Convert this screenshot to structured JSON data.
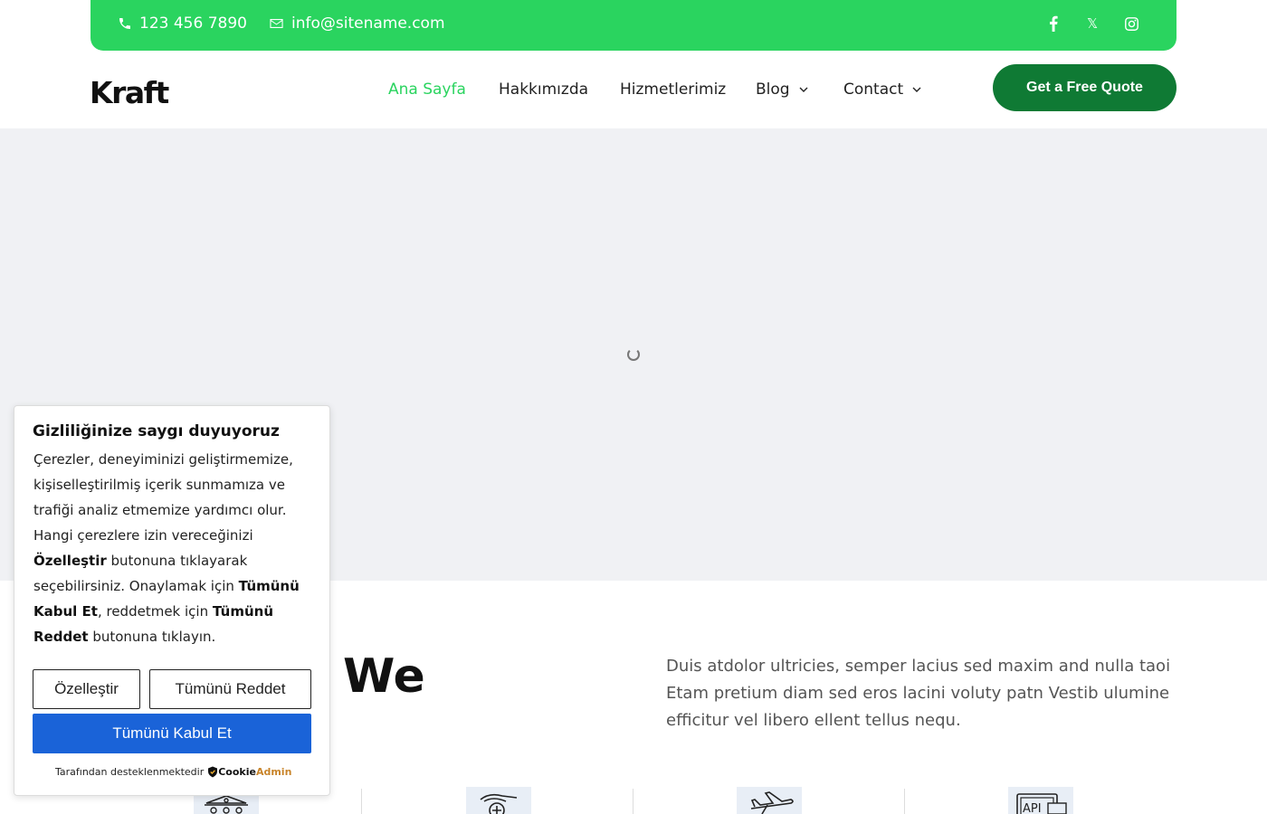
{
  "topbar": {
    "phone": "123 456 7890",
    "email": "info@sitename.com",
    "social": [
      "facebook-icon",
      "x-twitter-icon",
      "instagram-icon"
    ],
    "x_glyph": "𝕏"
  },
  "header": {
    "logo": "Kraft",
    "nav": [
      {
        "label": "Ana Sayfa",
        "active": true
      },
      {
        "label": "Hakkımızda"
      },
      {
        "label": "Hizmetlerimiz"
      },
      {
        "label": "Blog",
        "dropdown": true
      },
      {
        "label": "Contact",
        "dropdown": true
      }
    ],
    "cta": "Get a Free Quote"
  },
  "section": {
    "title_visible": "s We",
    "description": "Duis atdolor ultricies, semper lacius sed maxim and nulla taoi Etam pretium diam sed eros lacini voluty patn Vestib ulumine efficitur vel libero ellent tellus nequ.",
    "service_icons": [
      "cart-icon",
      "hand-medical-icon",
      "airplane-icon",
      "api-icon"
    ]
  },
  "cookie": {
    "title": "Gizliliğinize saygı duyuyoruz",
    "text_1": "Çerezler, deneyiminizi geliştirmemize, kişiselleştirilmiş içerik sunmamıza ve trafiği analiz etmemize yardımcı olur. Hangi çerezlere izin vereceğinizi ",
    "bold_customize": "Özelleştir",
    "text_2": " butonuna tıklayarak seçebilirsiniz. Onaylamak için ",
    "bold_accept": "Tümünü Kabul Et",
    "text_3": ", reddetmek için ",
    "bold_reject": "Tümünü Reddet",
    "text_4": " butonuna tıklayın.",
    "btn_customize": "Özelleştir",
    "btn_reject": "Tümünü Reddet",
    "btn_accept": "Tümünü Kabul Et",
    "powered_by": "Tarafından desteklenmektedir",
    "brand_1": "Cookie",
    "brand_2": "Admin"
  },
  "colors": {
    "brand_green": "#2ad45f",
    "dark_green": "#0f7a34",
    "accept_blue": "#1a63d8",
    "hero_bg": "#f0f1f4"
  }
}
